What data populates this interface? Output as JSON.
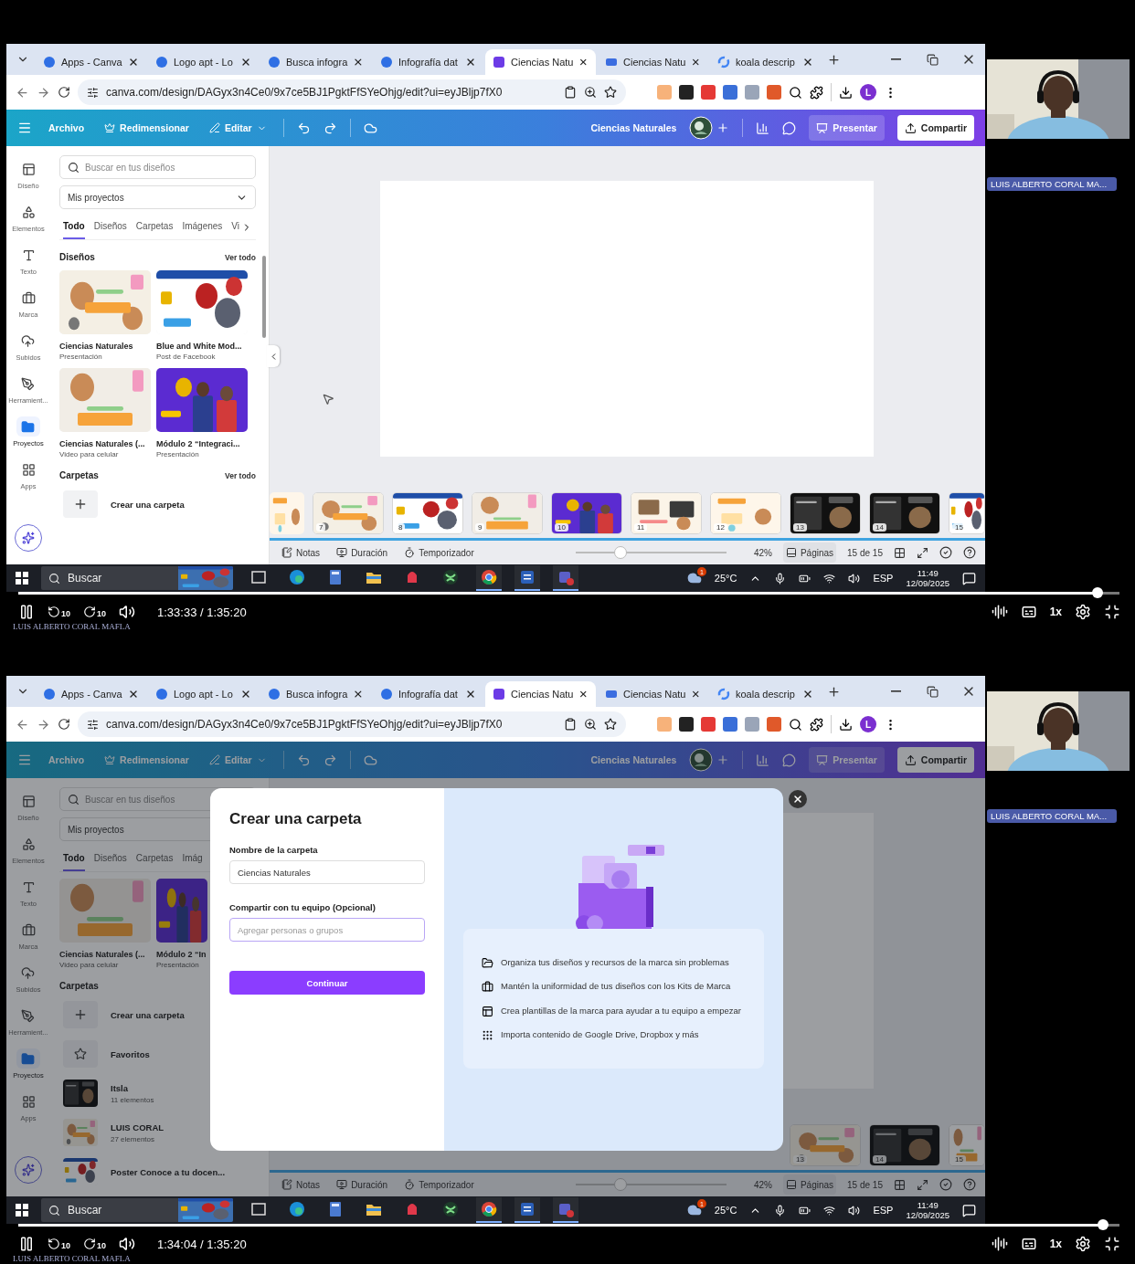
{
  "frames": [
    {
      "browser": {
        "tabs": [
          {
            "label": "Apps - Canva",
            "kind": "canva",
            "selected": false
          },
          {
            "label": "Logo apt - Lo",
            "kind": "canva",
            "selected": false
          },
          {
            "label": "Busca infogra",
            "kind": "canva",
            "selected": false
          },
          {
            "label": "Infografía dat",
            "kind": "canva",
            "selected": false
          },
          {
            "label": "Ciencias Natu",
            "kind": "design",
            "selected": true
          },
          {
            "label": "Ciencias Natu",
            "kind": "video",
            "selected": false
          },
          {
            "label": "koala descrip",
            "kind": "search",
            "selected": false
          }
        ],
        "url": "canva.com/design/DAGyx3n4Ce0/9x7ce5BJ1PgktFfSYeOhjg/edit?ui=eyJBljp7fX0",
        "profile_initial": "L"
      },
      "editor": {
        "header": {
          "menu": [
            {
              "label": "Archivo",
              "kind": "plain"
            },
            {
              "label": "Redimensionar",
              "kind": "resize"
            },
            {
              "label": "Editar",
              "kind": "edit"
            }
          ],
          "title": "Ciencias Naturales",
          "present": "Presentar",
          "share": "Compartir"
        },
        "rail": [
          {
            "label": "Diseño",
            "kind": "design",
            "selected": false
          },
          {
            "label": "Elementos",
            "kind": "elements",
            "selected": false
          },
          {
            "label": "Texto",
            "kind": "text",
            "selected": false
          },
          {
            "label": "Marca",
            "kind": "brand",
            "selected": false
          },
          {
            "label": "Subidos",
            "kind": "uploads",
            "selected": false
          },
          {
            "label": "Herramient...",
            "kind": "tools",
            "selected": false
          },
          {
            "label": "Proyectos",
            "kind": "projects",
            "selected": true
          },
          {
            "label": "Apps",
            "kind": "apps",
            "selected": false
          }
        ],
        "panel": {
          "search": {
            "placeholder": "Buscar en tus diseños"
          },
          "dropdown": "Mis proyectos",
          "tabs": [
            {
              "label": "Todo",
              "selected": true
            },
            {
              "label": "Diseños",
              "selected": false
            },
            {
              "label": "Carpetas",
              "selected": false
            },
            {
              "label": "Imágenes",
              "selected": false
            },
            {
              "label": "Vi",
              "selected": false
            }
          ],
          "sections": [
            {
              "kind": "designs",
              "title": "Diseños",
              "link": "Ver todo",
              "items": [
                {
                  "title": "Ciencias Naturales",
                  "subtitle": "Presentación"
                },
                {
                  "title": "Blue and White Mod...",
                  "subtitle": "Post de Facebook"
                },
                {
                  "title": "Ciencias Naturales (...",
                  "subtitle": "Video para celular"
                },
                {
                  "title": "Módulo 2 “Integraci...",
                  "subtitle": "Presentación"
                }
              ]
            },
            {
              "kind": "folders",
              "title": "Carpetas",
              "link": "Ver todo",
              "items": [
                {
                  "kind": "create",
                  "title": "Crear una carpeta"
                }
              ]
            }
          ]
        },
        "thumbnails": [
          {
            "number": "7"
          },
          {
            "number": "8"
          },
          {
            "number": "9"
          },
          {
            "number": "10"
          },
          {
            "number": "11"
          },
          {
            "number": "12"
          },
          {
            "number": "13"
          },
          {
            "number": "14"
          },
          {
            "number": "15"
          }
        ],
        "bottom_bar": {
          "notes": "Notas",
          "duration": "Duración",
          "timer": "Temporizador",
          "zoom_slider": {
            "level": 0.3
          },
          "zoom": "42%",
          "pages": "Páginas",
          "page_count": "15 de 15"
        }
      },
      "taskbar": {
        "search": "Buscar",
        "apps": [
          {
            "kind": "task-view",
            "running": false
          },
          {
            "kind": "edge",
            "running": false
          },
          {
            "kind": "calculator",
            "running": false
          },
          {
            "kind": "files",
            "running": false
          },
          {
            "kind": "red-app",
            "running": false
          },
          {
            "kind": "green-app",
            "running": false
          },
          {
            "kind": "chrome",
            "running": true
          },
          {
            "kind": "word",
            "running": true
          },
          {
            "kind": "teams",
            "running": true
          }
        ],
        "weather_badge": "1",
        "temperature": "25°C",
        "language": "ESP",
        "time": "11:49",
        "date": "12/09/2025"
      },
      "participant": {
        "name": "LUIS ALBERTO CORAL MA..."
      },
      "player": {
        "progress": {
          "level": 0.98
        },
        "skip_back": "10",
        "skip_forward": "10",
        "time": "1:33:33 / 1:35:20",
        "speed": "1x",
        "caption": "LUIS ALBERTO CORAL MAFLA"
      }
    },
    {
      "browser": {
        "tabs": [
          {
            "label": "Apps - Canva",
            "kind": "canva",
            "selected": false
          },
          {
            "label": "Logo apt - Lo",
            "kind": "canva",
            "selected": false
          },
          {
            "label": "Busca infogra",
            "kind": "canva",
            "selected": false
          },
          {
            "label": "Infografía dat",
            "kind": "canva",
            "selected": false
          },
          {
            "label": "Ciencias Natu",
            "kind": "design",
            "selected": true
          },
          {
            "label": "Ciencias Natu",
            "kind": "video",
            "selected": false
          },
          {
            "label": "koala descrip",
            "kind": "search",
            "selected": false
          }
        ],
        "url": "canva.com/design/DAGyx3n4Ce0/9x7ce5BJ1PgktFfSYeOhjg/edit?ui=eyJBljp7fX0",
        "profile_initial": "L"
      },
      "editor": {
        "header": {
          "menu": [
            {
              "label": "Archivo",
              "kind": "plain"
            },
            {
              "label": "Redimensionar",
              "kind": "resize"
            },
            {
              "label": "Editar",
              "kind": "edit"
            }
          ],
          "title": "Ciencias Naturales",
          "present": "Presentar",
          "share": "Compartir"
        },
        "rail": [
          {
            "label": "Diseño",
            "kind": "design",
            "selected": false
          },
          {
            "label": "Elementos",
            "kind": "elements",
            "selected": false
          },
          {
            "label": "Texto",
            "kind": "text",
            "selected": false
          },
          {
            "label": "Marca",
            "kind": "brand",
            "selected": false
          },
          {
            "label": "Subidos",
            "kind": "uploads",
            "selected": false
          },
          {
            "label": "Herramient...",
            "kind": "tools",
            "selected": false
          },
          {
            "label": "Proyectos",
            "kind": "projects",
            "selected": true
          },
          {
            "label": "Apps",
            "kind": "apps",
            "selected": false
          }
        ],
        "panel": {
          "search": {
            "placeholder": "Buscar en tus diseños"
          },
          "dropdown": "Mis proyectos",
          "tabs": [
            {
              "label": "Todo",
              "selected": true
            },
            {
              "label": "Diseños",
              "selected": false
            },
            {
              "label": "Carpetas",
              "selected": false
            },
            {
              "label": "Imág",
              "selected": false
            }
          ],
          "sections": [
            {
              "kind": "designs",
              "items": [
                {
                  "title": "Ciencias Naturales (...",
                  "subtitle": "Video para celular"
                },
                {
                  "title": "Módulo 2 “In",
                  "subtitle": "Presentación"
                }
              ]
            },
            {
              "kind": "folders",
              "title": "Carpetas",
              "items": [
                {
                  "kind": "create",
                  "title": "Crear una carpeta"
                },
                {
                  "kind": "favorites",
                  "title": "Favoritos"
                },
                {
                  "kind": "folder",
                  "title": "Itsla",
                  "subtitle": "11 elementos"
                },
                {
                  "kind": "folder",
                  "title": "LUIS CORAL",
                  "subtitle": "27 elementos"
                },
                {
                  "kind": "file",
                  "title": "Poster Conoce a tu docen..."
                }
              ]
            }
          ]
        },
        "thumbnails": [
          {
            "number": "13"
          },
          {
            "number": "14"
          },
          {
            "number": "15"
          }
        ],
        "bottom_bar": {
          "notes": "Notas",
          "duration": "Duración",
          "timer": "Temporizador",
          "zoom_slider": {
            "level": 0.3
          },
          "zoom": "42%",
          "pages": "Páginas",
          "page_count": "15 de 15"
        },
        "modal": {
          "title": "Crear una carpeta",
          "name_field": {
            "label": "Nombre de la carpeta",
            "value": "Ciencias Naturales"
          },
          "share_field": {
            "label": "Compartir con tu equipo (Opcional)",
            "placeholder": "Agregar personas o grupos"
          },
          "submit": "Continuar",
          "features": [
            {
              "kind": "folder",
              "text": "Organiza tus diseños y recursos de la marca sin problemas"
            },
            {
              "kind": "brand",
              "text": "Mantén la uniformidad de tus diseños con los Kits de Marca"
            },
            {
              "kind": "template",
              "text": "Crea plantillas de la marca para ayudar a tu equipo a empezar"
            },
            {
              "kind": "apps",
              "text": "Importa contenido de Google Drive, Dropbox y más"
            }
          ]
        }
      },
      "taskbar": {
        "search": "Buscar",
        "apps": [
          {
            "kind": "task-view",
            "running": false
          },
          {
            "kind": "edge",
            "running": false
          },
          {
            "kind": "calculator",
            "running": false
          },
          {
            "kind": "files",
            "running": false
          },
          {
            "kind": "red-app",
            "running": false
          },
          {
            "kind": "green-app",
            "running": false
          },
          {
            "kind": "chrome",
            "running": true
          },
          {
            "kind": "word",
            "running": true
          },
          {
            "kind": "teams",
            "running": true
          }
        ],
        "weather_badge": "1",
        "temperature": "25°C",
        "language": "ESP",
        "time": "11:49",
        "date": "12/09/2025"
      },
      "participant": {
        "name": "LUIS ALBERTO CORAL MA..."
      },
      "player": {
        "progress": {
          "level": 0.985
        },
        "skip_back": "10",
        "skip_forward": "10",
        "time": "1:34:04 / 1:35:20",
        "speed": "1x",
        "caption": "LUIS ALBERTO CORAL MAFLA"
      }
    }
  ]
}
